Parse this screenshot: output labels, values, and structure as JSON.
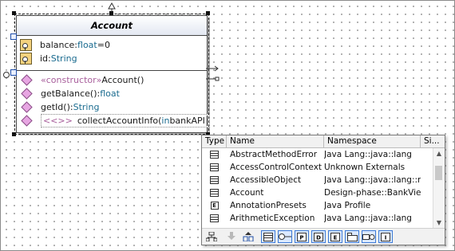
{
  "class": {
    "name": "Account",
    "attributes": [
      {
        "name": "balance:",
        "type": "float",
        "suffix": "=0"
      },
      {
        "name": "id:",
        "type": "String",
        "suffix": ""
      }
    ],
    "operations": [
      {
        "stereo": "«constructor»",
        "name": " Account()",
        "type": ""
      },
      {
        "stereo": "",
        "name": "getBalance():",
        "type": "float"
      },
      {
        "stereo": "",
        "name": "getId():",
        "type": "String"
      }
    ],
    "editing": {
      "stereo": "<<>>",
      "name": "collectAccountInfo(",
      "kw": "in",
      "rest": " bankAPI"
    }
  },
  "popup": {
    "columns": {
      "type": "Type",
      "name": "Name",
      "namespace": "Namespace",
      "size": "Si..."
    },
    "items": [
      {
        "icon": "class-icon",
        "name": "AbstractMethodError",
        "namespace": "Java Lang::java::lang"
      },
      {
        "icon": "class-icon",
        "name": "AccessControlContext",
        "namespace": "Unknown Externals"
      },
      {
        "icon": "class-icon",
        "name": "AccessibleObject",
        "namespace": "Java Lang::java::lang::re"
      },
      {
        "icon": "class-icon",
        "name": "Account",
        "namespace": "Design-phase::BankVie"
      },
      {
        "icon": "enum-icon",
        "name": "AnnotationPresets",
        "namespace": "Java Profile"
      },
      {
        "icon": "class-icon",
        "name": "ArithmeticException",
        "namespace": "Java Lang::java::lang"
      }
    ],
    "enum_glyph": "E",
    "toolbar_letters": [
      "P",
      "D",
      "E",
      "I"
    ]
  }
}
